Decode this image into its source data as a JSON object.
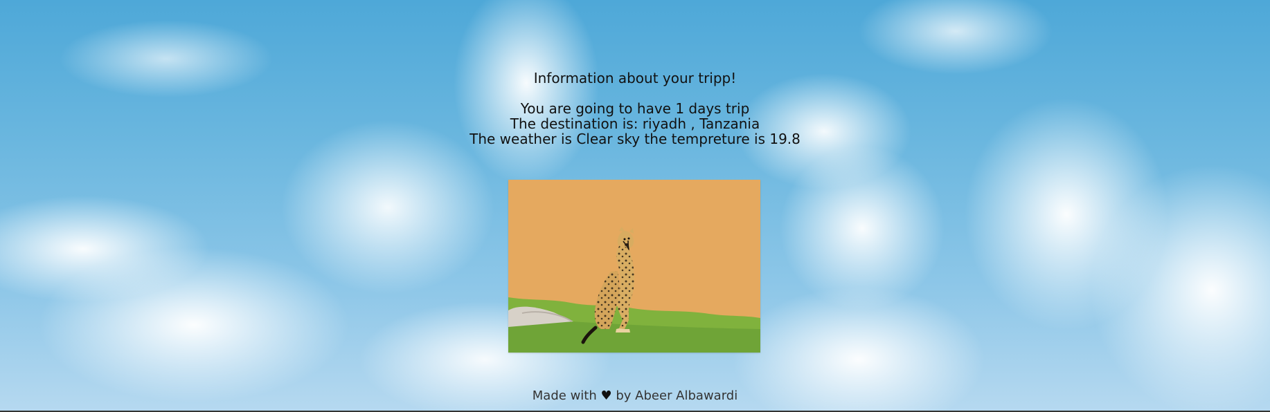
{
  "trip": {
    "heading": "Information about your tripp!",
    "days_line": "You are going to have 1 days trip",
    "destination_line": "The destination is: riyadh , Tanzania",
    "weather_line": "The weather is Clear sky the tempreture is 19.8"
  },
  "footer": {
    "prefix": "Made with",
    "heart": "♥",
    "suffix": "by Abeer Albawardi"
  }
}
